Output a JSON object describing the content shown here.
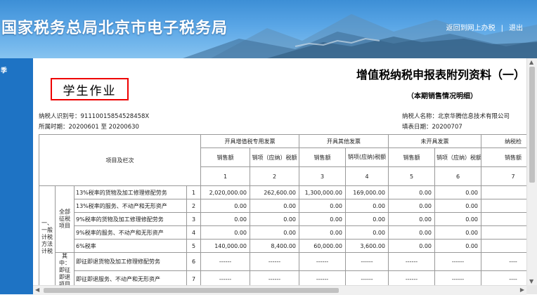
{
  "header": {
    "site_title": "国家税务总局北京市电子税务局",
    "return_link": "返回到网上办税",
    "separator": "|",
    "logout_link": "退出"
  },
  "sidebar": {
    "label": "季"
  },
  "document": {
    "title": "增值税纳税申报表附列资料（一）",
    "stamp_text": "学生作业",
    "subtitle": "（本期销售情况明细）",
    "taxpayer_id": "纳税人识别号：91110015854528458X",
    "period": "所属时期：20200601  至 20200630",
    "taxpayer_name": "纳税人名称：北京华腾信息技术有限公司",
    "fill_date": "填表日期：20200707"
  },
  "table": {
    "header_item": "项目及栏次",
    "group_headers": [
      "开具增值税专用发票",
      "开具其他发票",
      "未开具发票",
      "纳税检"
    ],
    "sub_headers": [
      "销售额",
      "销项（应纳）税额",
      "销售额",
      "销项(应纳)税额",
      "销售额",
      "销项（应纳）税额",
      "销售额"
    ],
    "col_numbers": [
      "1",
      "2",
      "3",
      "4",
      "5",
      "6",
      "7"
    ],
    "section_general": "一、一般计税方法计税",
    "group_all": "全部征税项目",
    "group_refund": "其中：即征即退项目",
    "rows": [
      {
        "label": "13%税率的货物及加工修理修配劳务",
        "num": "1",
        "vals": [
          "2,020,000.00",
          "262,600.00",
          "1,300,000.00",
          "169,000.00",
          "0.00",
          "0.00",
          "0."
        ]
      },
      {
        "label": "13%税率的服务、不动产和无形资产",
        "num": "2",
        "vals": [
          "0.00",
          "0.00",
          "0.00",
          "0.00",
          "0.00",
          "0.00",
          "0."
        ]
      },
      {
        "label": "9%税率的货物及加工修理修配劳务",
        "num": "3",
        "vals": [
          "0.00",
          "0.00",
          "0.00",
          "0.00",
          "0.00",
          "0.00",
          "0."
        ]
      },
      {
        "label": "9%税率的服务、不动产和无形资产",
        "num": "4",
        "vals": [
          "0.00",
          "0.00",
          "0.00",
          "0.00",
          "0.00",
          "0.00",
          "0."
        ]
      },
      {
        "label": "6%税率",
        "num": "5",
        "vals": [
          "140,000.00",
          "8,400.00",
          "60,000.00",
          "3,600.00",
          "0.00",
          "0.00",
          "0."
        ]
      },
      {
        "label": "即征即退货物及加工修理修配劳务",
        "num": "6",
        "vals": [
          "------",
          "------",
          "------",
          "------",
          "------",
          "------",
          "----"
        ]
      },
      {
        "label": "即征即退服务、不动产和无形资产",
        "num": "7",
        "vals": [
          "------",
          "------",
          "------",
          "------",
          "------",
          "------",
          "----"
        ]
      }
    ]
  }
}
